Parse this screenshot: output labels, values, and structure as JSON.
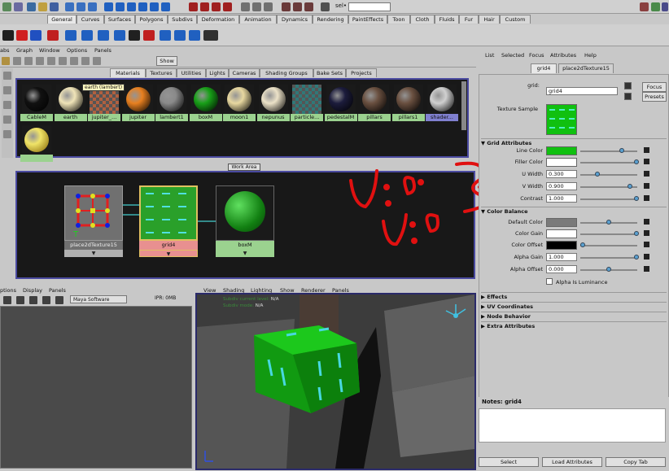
{
  "status": {
    "sel_label": "sel•"
  },
  "shelf": {
    "tabs": [
      "General",
      "Curves",
      "Surfaces",
      "Polygons",
      "Subdivs",
      "Deformation",
      "Animation",
      "Dynamics",
      "Rendering",
      "PaintEffects",
      "Toon",
      "Cloth",
      "Fluids",
      "Fur",
      "Hair",
      "Custom"
    ]
  },
  "hypershade": {
    "menu": [
      "abs",
      "Graph",
      "Window",
      "Options",
      "Panels"
    ],
    "show_button": "Show",
    "tabs": [
      "Materials",
      "Textures",
      "Utilities",
      "Lights",
      "Cameras",
      "Shading Groups",
      "Bake Sets",
      "Projects"
    ],
    "tooltip": "earth (lambert)",
    "swatches": [
      {
        "label": "CableM",
        "color": "#111111"
      },
      {
        "label": "earth",
        "color": "#f0e4b8"
      },
      {
        "label": "jupiter_...",
        "color": "#b06040"
      },
      {
        "label": "jupiter",
        "color": "#e88020"
      },
      {
        "label": "lambert1",
        "color": "#8a8a8a"
      },
      {
        "label": "boxM",
        "color": "#18a018"
      },
      {
        "label": "moon1",
        "color": "#e8d8a0"
      },
      {
        "label": "nepunus",
        "color": "#ece2c8"
      },
      {
        "label": "particle...",
        "color": "#307878"
      },
      {
        "label": "pedestalM",
        "color": "#1c1c3c"
      },
      {
        "label": "pillars",
        "color": "#6a5040"
      },
      {
        "label": "pillars1",
        "color": "#6a5040"
      },
      {
        "label": "shader...",
        "color": "#d0d0d0"
      }
    ],
    "swatch_row2": {
      "label": "",
      "color": "#f0e468"
    },
    "work_area_tab": "Work Area",
    "nodes": [
      {
        "label": "place2dTexture15",
        "bar": "▼"
      },
      {
        "label": "grid4",
        "bar": "▼"
      },
      {
        "label": "boxM",
        "bar": "▼"
      }
    ]
  },
  "render_view": {
    "menu": [
      "ptions",
      "Display",
      "Panels"
    ],
    "renderer": "Maya Software",
    "ipr": "IPR: 0MB"
  },
  "perspective": {
    "menu": [
      "View",
      "Shading",
      "Lighting",
      "Show",
      "Renderer",
      "Panels"
    ],
    "hud": [
      {
        "label": "Subdiv current level:",
        "value": "N/A"
      },
      {
        "label": "Subdiv mode:",
        "value": "N/A"
      }
    ]
  },
  "attribute_editor": {
    "menu": [
      "List",
      "Selected",
      "Focus",
      "Attributes",
      "Help"
    ],
    "tabs": [
      "grid4",
      "place2dTexture15"
    ],
    "grid_label": "grid:",
    "grid_value": "grid4",
    "focus_button": "Focus",
    "presets_button": "Presets",
    "texture_sample_label": "Texture Sample",
    "grid_attributes": {
      "title": "Grid Attributes",
      "line_color_label": "Line Color",
      "line_color": "#10c010",
      "filler_color_label": "Filler Color",
      "filler_color": "#ffffff",
      "u_width_label": "U Width",
      "u_width_value": "0.300",
      "v_width_label": "V Width",
      "v_width_value": "0.900",
      "contrast_label": "Contrast",
      "contrast_value": "1.000"
    },
    "color_balance": {
      "title": "Color Balance",
      "default_color_label": "Default Color",
      "default_color": "#7a7a7a",
      "color_gain_label": "Color Gain",
      "color_gain": "#ffffff",
      "color_offset_label": "Color Offset",
      "color_offset": "#000000",
      "alpha_gain_label": "Alpha Gain",
      "alpha_gain_value": "1.000",
      "alpha_offset_label": "Alpha Offset",
      "alpha_offset_value": "0.000",
      "alpha_lum_label": "Alpha Is Luminance"
    },
    "sections": [
      "Effects",
      "UV Coordinates",
      "Node Behavior",
      "Extra Attributes"
    ],
    "notes_label": "Notes: grid4",
    "buttons": [
      "Select",
      "Load Attributes",
      "Copy Tab"
    ]
  },
  "annotation": {
    "u_text": "U: 0.3",
    "v_text": "V: 0.9",
    "color": "#e01010"
  }
}
